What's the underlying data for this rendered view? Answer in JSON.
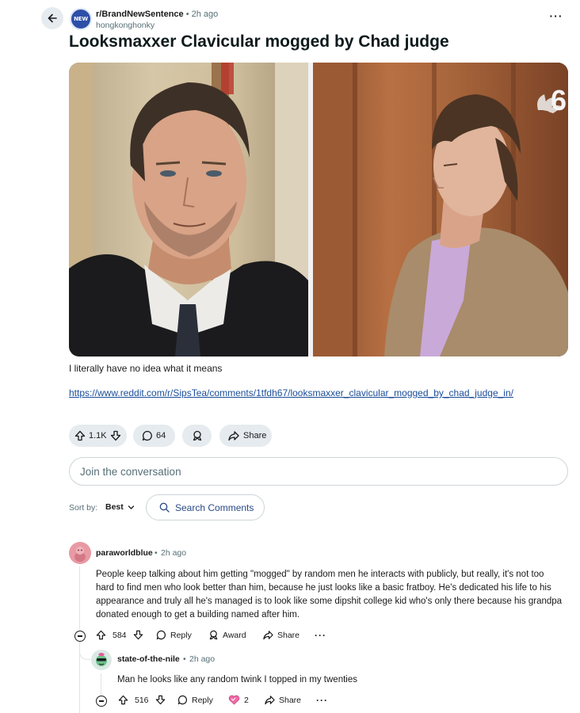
{
  "post": {
    "subreddit": "r/BrandNewSentence",
    "subreddit_avatar_text": "NEW",
    "time_sep": "•",
    "time": "2h ago",
    "author": "hongkonghonky",
    "more": "···",
    "title": "Looksmaxxer Clavicular mogged by Chad judge",
    "body": "I literally have no idea what it means",
    "link": "https://www.reddit.com/r/SipsTea/comments/1tfdh67/looksmaxxer_clavicular_mogged_by_chad_judge_in/",
    "image_watermark": "6",
    "votes": "1.1K",
    "comments": "64",
    "share_label": "Share"
  },
  "composer": {
    "placeholder": "Join the conversation"
  },
  "sort": {
    "label": "Sort by:",
    "value": "Best",
    "search_placeholder": "Search Comments"
  },
  "comments": [
    {
      "author": "paraworldblue",
      "time_sep": "•",
      "time": "2h ago",
      "text": "People keep talking about him getting \"mogged\" by random men he interacts with publicly, but really, it's not too hard to find men who look better than him, because he just looks like a basic fratboy. He's dedicated his life to his appearance and truly all he's managed is to look like some dipshit college kid who's only there because his grandpa donated enough to get a building named after him.",
      "votes": "584",
      "reply_label": "Reply",
      "award_label": "Award",
      "share_label": "Share",
      "more": "···"
    },
    {
      "author": "state-of-the-nile",
      "time_sep": "•",
      "time": "2h ago",
      "text": "Man he looks like any random twink I topped in my twenties",
      "votes": "516",
      "reply_label": "Reply",
      "award_count": "2",
      "share_label": "Share",
      "more": "···"
    }
  ],
  "colors": {
    "pill_bg": "#e5ebee",
    "link": "#1a4d9a",
    "muted": "#576f76",
    "subreddit_avatar": "#2d4fa8",
    "thread_line": "#dfe3e5"
  },
  "icons": [
    "back-arrow-icon",
    "upvote-icon",
    "downvote-icon",
    "comment-icon",
    "award-icon",
    "share-icon",
    "search-icon",
    "chevron-down-icon",
    "collapse-icon",
    "more-dots-icon"
  ]
}
